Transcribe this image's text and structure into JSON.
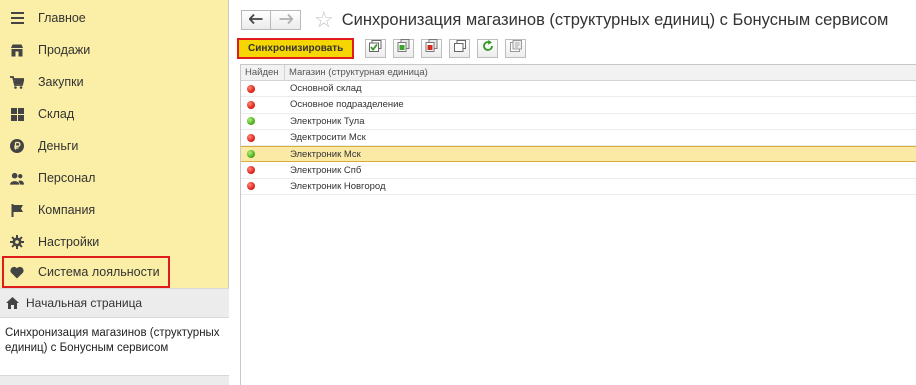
{
  "sidebar": {
    "items": [
      {
        "label": "Главное",
        "icon": "menu-icon"
      },
      {
        "label": "Продажи",
        "icon": "shop-icon"
      },
      {
        "label": "Закупки",
        "icon": "cart-icon"
      },
      {
        "label": "Склад",
        "icon": "warehouse-icon"
      },
      {
        "label": "Деньги",
        "icon": "ruble-icon"
      },
      {
        "label": "Персонал",
        "icon": "people-icon"
      },
      {
        "label": "Компания",
        "icon": "flag-icon"
      },
      {
        "label": "Настройки",
        "icon": "gear-icon"
      },
      {
        "label": "Система лояльности",
        "icon": "heart-icon",
        "highlighted": true
      }
    ],
    "home_label": "Начальная страница",
    "open_page_label": "Синхронизация магазинов (структурных единиц) с Бонусным сервисом"
  },
  "header": {
    "title": "Синхронизация магазинов (структурных единиц) с Бонусным сервисом",
    "back_icon": "arrow-left-icon",
    "forward_icon": "arrow-right-icon",
    "favorite_icon": "star-icon"
  },
  "toolbar": {
    "sync_label": "Синхронизировать",
    "icons": [
      "check-all-icon",
      "copy-green-icon",
      "copy-red-icon",
      "window-icon",
      "refresh-icon",
      "settings-sheet-icon"
    ]
  },
  "table": {
    "columns": [
      "Найден",
      "Магазин (структурная единица)"
    ],
    "rows": [
      {
        "found": "red",
        "name": "Основной склад"
      },
      {
        "found": "red",
        "name": "Основное подразделение"
      },
      {
        "found": "green",
        "name": "Электроник Тула"
      },
      {
        "found": "red",
        "name": "Эдектросити Мск"
      },
      {
        "found": "green",
        "name": "Электроник Мск",
        "selected": true
      },
      {
        "found": "red",
        "name": "Электроник Спб"
      },
      {
        "found": "red",
        "name": "Электроник Новгород"
      }
    ]
  },
  "colors": {
    "sidebar_bg": "#fbeea6",
    "highlight": "#e01b1b",
    "sync_button": "#f6d600",
    "status_red": "#e0251c",
    "status_green": "#4eb021"
  }
}
